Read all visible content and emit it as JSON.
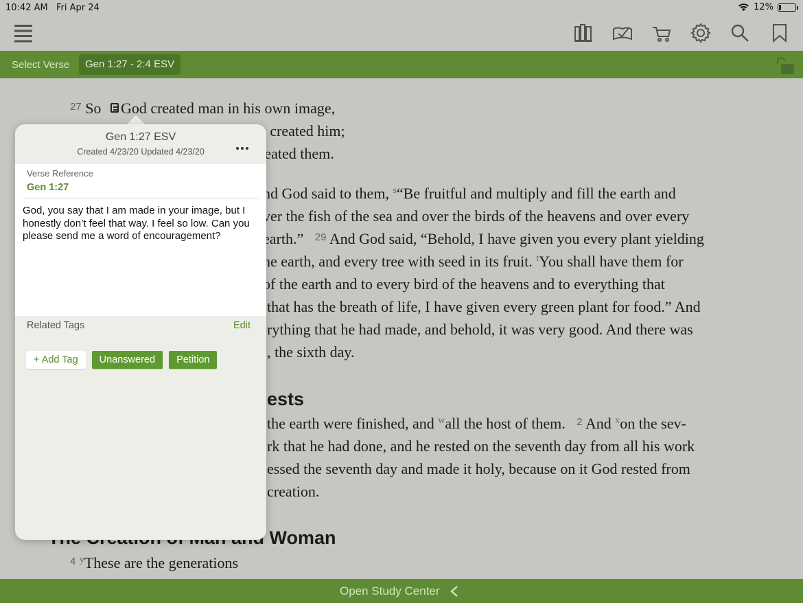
{
  "status": {
    "time": "10:42 AM",
    "date": "Fri Apr 24",
    "battery": "12%",
    "battery_level": 0.12
  },
  "toolbar": {
    "icons": [
      "menu-icon",
      "library-icon",
      "reading-plan-icon",
      "cart-icon",
      "settings-icon",
      "search-icon",
      "bookmark-icon"
    ]
  },
  "context": {
    "select_verse": "Select Verse",
    "reference": "Gen 1:27 - 2:4 ESV"
  },
  "reading": {
    "v27_num": "27",
    "v27_a": "So ",
    "v27_b": "God created man in his own image,",
    "l2": "e created him;",
    "l3": "reated them.",
    "l4_a": "nd God said to them, ",
    "l4_ref": "s",
    "l4_b": "“Be fruitful and multiply and fill the earth and",
    "l5": "ver the fish of the sea and over the birds of the heavens and over every",
    "l6_a": "earth.”",
    "l6_num": "29",
    "l6_b": " And God said, “Behold, I have given you every plant yielding",
    "l7_a": "he earth, and every tree with seed in its fruit. ",
    "l7_ref": "t",
    "l7_b": "You shall have them for",
    "l8": "of the earth and to every bird of the heavens and to everything that",
    "l9": "that has the breath of life, I have given every green plant for food.” And",
    "l10": "rything that he had made, and behold, it was very good. And there was",
    "l11": ", the sixth day.",
    "heading1": "ests",
    "l12_a": "the earth were finished, and ",
    "l12_ref": "w",
    "l12_b": "all the host of them.",
    "l12_num": "2",
    "l12_c": " And ",
    "l12_ref2": "x",
    "l12_d": "on the sev-",
    "l13": "rk that he had done, and he rested on the seventh day from all his work",
    "l14": "essed the seventh day and made it holy, because on it God rested from",
    "l15": "creation.",
    "heading2": "The Creation of Man and Woman",
    "v4_num": "4",
    "v4_ref": "y",
    "v4_text": "These are the generations"
  },
  "popover": {
    "title": "Gen 1:27 ESV",
    "subtitle": "Created 4/23/20 Updated 4/23/20",
    "ref_label": "Verse Reference",
    "ref_value": "Gen 1:27",
    "note": "God, you say that I am made in your image, but I honestly don’t feel that way. I feel so low. Can you please send me a word of encouragement?",
    "tags_label": "Related Tags",
    "edit": "Edit",
    "add_tag": "+ Add Tag",
    "tags": [
      "Unanswered",
      "Petition"
    ]
  },
  "bottom": {
    "open_study": "Open Study Center"
  },
  "colors": {
    "accent_green": "#5f8b34",
    "tag_green": "#5f9a31",
    "link_green": "#5c8d2e"
  }
}
